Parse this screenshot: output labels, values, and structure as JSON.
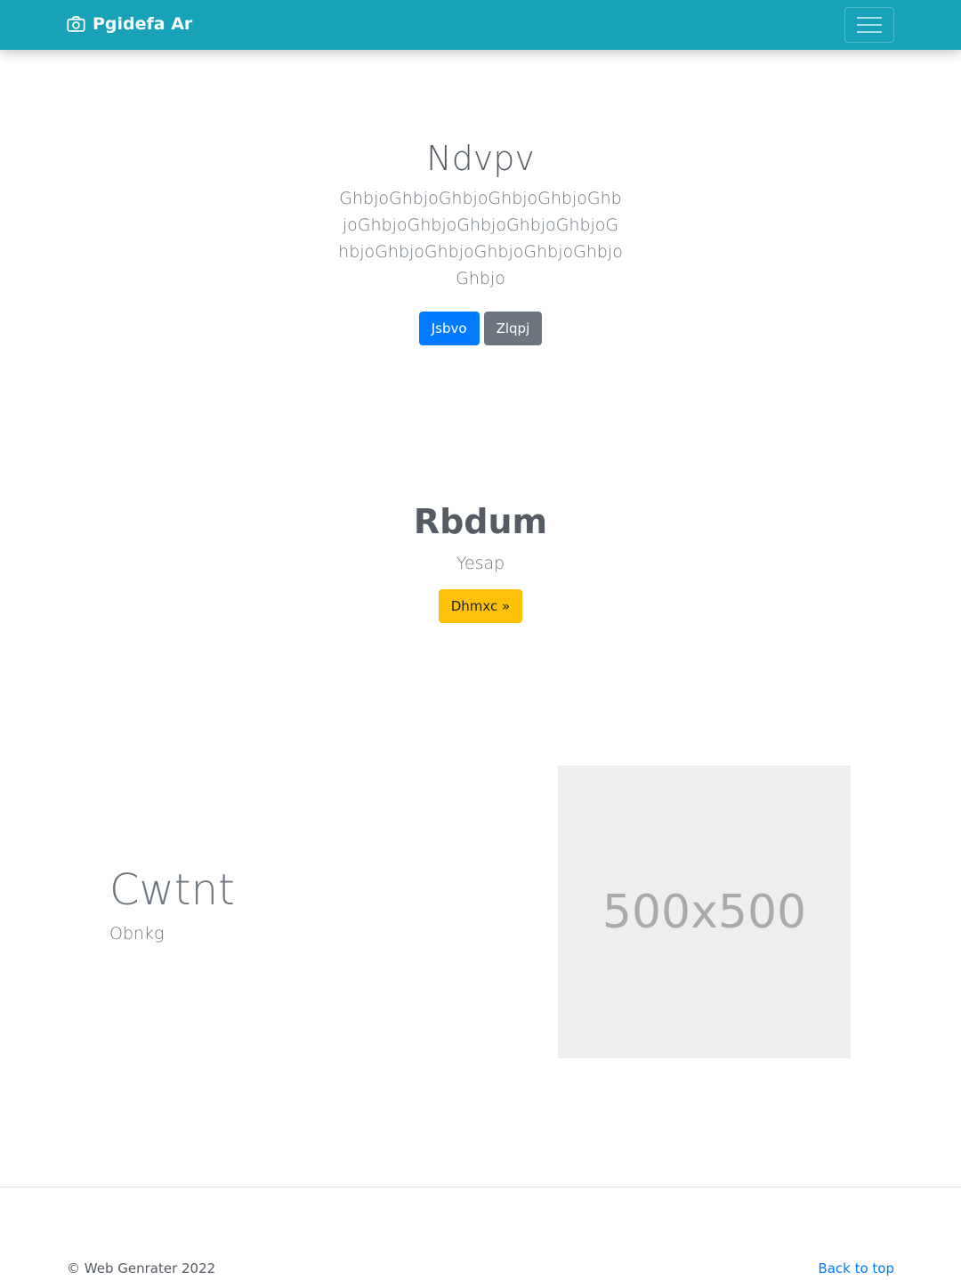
{
  "navbar": {
    "brand": "Pgidefa Ar",
    "brand_icon": "camera-icon",
    "toggler_icon": "hamburger-menu-icon",
    "background": "#17a2b8"
  },
  "hero": {
    "title": "Ndvpv",
    "lead": "GhbjoGhbjoGhbjoGhbjoGhbjoGhbjoGhbjoGhbjoGhbjoGhbjoGhbjoGhbjoGhbjoGhbjoGhbjoGhbjoGhbjoGhbjo",
    "primary_label": "Jsbvo",
    "secondary_label": "Zlqpj"
  },
  "cta": {
    "title": "Rbdum",
    "subtitle": "Yesap",
    "button_label": "Dhmxc »"
  },
  "feature": {
    "title": "Cwtnt",
    "subtitle": "Obnkg",
    "image_label": "500x500"
  },
  "footer": {
    "copyright": "© Web Genrater 2022",
    "back_to_top": "Back to top"
  },
  "colors": {
    "primary": "#007bff",
    "secondary": "#6c757d",
    "warning": "#ffc107",
    "navbar": "#17a2b8"
  }
}
